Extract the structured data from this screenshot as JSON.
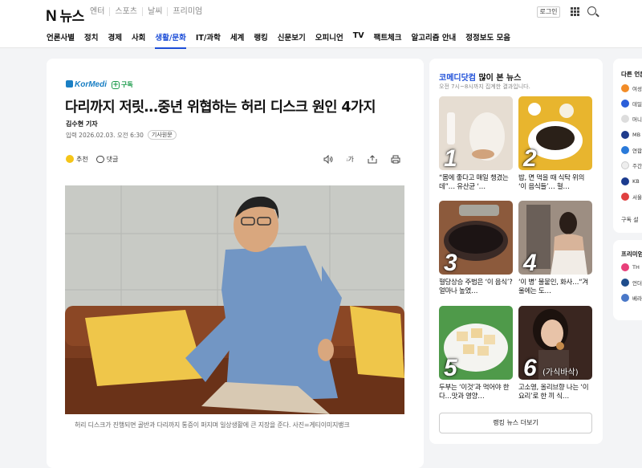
{
  "header": {
    "logo_mark": "N",
    "logo_text": "뉴스",
    "top_links": [
      "엔터",
      "스포츠",
      "날씨",
      "프리미엄"
    ],
    "login_label": "로그인"
  },
  "categories": [
    "언론사별",
    "정치",
    "경제",
    "사회",
    "생활/문화",
    "IT/과학",
    "세계",
    "랭킹",
    "신문보기",
    "오피니언",
    "TV",
    "팩트체크",
    "알고리즘 안내",
    "정정보도 모음"
  ],
  "active_category": "생활/문화",
  "article": {
    "press": "KorMedi",
    "subscribe_label": "구독",
    "title": "다리까지 저릿…중년 위협하는 허리 디스크 원인 4가지",
    "reporter": "김수현 기자",
    "date_label": "입력 2026.02.03. 오전 6:30",
    "original_label": "기사원문",
    "recommend_label": "추천",
    "comment_label": "댓글",
    "font_label": "가",
    "caption": "허리 디스크가 진행되면 골반과 다리까지 통증이 퍼지며 일상생활에 큰 지장을 준다. 사진=게티이미지뱅크"
  },
  "ranking": {
    "press_name": "코메디닷컴",
    "title_suffix": " 많이 본 뉴스",
    "note": "오전 7시~8시까지 집계한 결과입니다.",
    "items": [
      {
        "rank": "1",
        "title": "“몸에 좋다고 매일 챙겼는데”… 유산균 ‘…"
      },
      {
        "rank": "2",
        "title": "밥, 면 먹을 때 식탁 위의 ‘이 음식들’… 혈…"
      },
      {
        "rank": "3",
        "title": "혈당상승 주범은 ‘이 음식’? 얼마나 높였…"
      },
      {
        "rank": "4",
        "title": "‘이 병’ 불붙인, 화사…“겨울에는 도…"
      },
      {
        "rank": "5",
        "title": "두부는 ‘이것’과 먹어야 한다…맛과 영양…"
      },
      {
        "rank": "6",
        "title": "고소영, 올리브향 나는 ‘이 요리’로 한 끼 식…"
      }
    ],
    "thumb_overlay_6": "(가식바삭)",
    "more_label": "랭킹 뉴스 더보기"
  },
  "other_press": {
    "title": "다른 언론",
    "items": [
      "여성",
      "데일",
      "머니",
      "MB",
      "연합",
      "주간",
      "KB",
      "서울"
    ],
    "footer": "구독 설"
  },
  "premium": {
    "title": "프리미엄",
    "items": [
      "TH",
      "언더",
      "베라"
    ]
  },
  "colors": {
    "accent": "#1d4ed8",
    "press_green": "#1a9a4a"
  }
}
